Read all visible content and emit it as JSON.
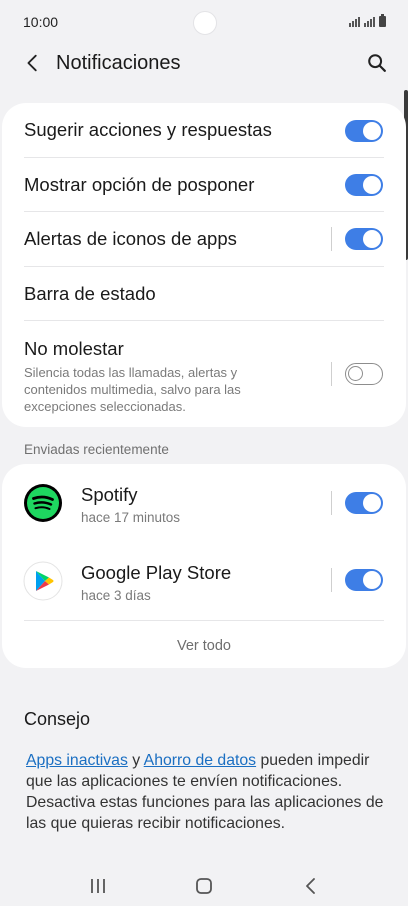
{
  "status_bar": {
    "time": "10:00"
  },
  "header": {
    "title": "Notificaciones",
    "back_icon": "back-arrow-icon",
    "search_icon": "search-icon"
  },
  "settings": [
    {
      "label": "Sugerir acciones y respuestas",
      "toggle": true
    },
    {
      "label": "Mostrar opción de posponer",
      "toggle": true
    },
    {
      "label": "Alertas de iconos de apps",
      "toggle": true
    },
    {
      "label": "Barra de estado"
    },
    {
      "label": "No molestar",
      "description": "Silencia todas las llamadas, alertas y contenidos multimedia, salvo para las excepciones seleccionadas.",
      "toggle": false
    }
  ],
  "recent": {
    "section_label": "Enviadas recientemente",
    "apps": [
      {
        "name": "Spotify",
        "time": "hace 17 minutos",
        "toggle": true,
        "icon": "spotify-icon"
      },
      {
        "name": "Google Play Store",
        "time": "hace 3 días",
        "toggle": true,
        "icon": "google-play-icon"
      }
    ],
    "see_all": "Ver todo"
  },
  "tip": {
    "title": "Consejo",
    "link1": "Apps inactivas",
    "connector": " y ",
    "link2": "Ahorro de datos",
    "text": " pueden impedir que las aplicaciones te envíen notificaciones. Desactiva estas funciones para las aplicaciones de las que quieras recibir notificaciones."
  },
  "colors": {
    "accent": "#3e7ee6",
    "link": "#1b6fc2",
    "background": "#f2f2f4",
    "spotify": "#1ed760"
  }
}
